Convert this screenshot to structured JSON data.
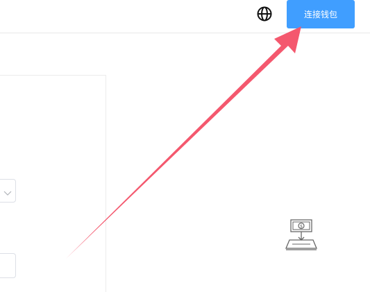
{
  "header": {
    "language_icon": "globe-icon",
    "connect_wallet_label": "连接钱包"
  },
  "colors": {
    "primary": "#409eff",
    "annotation_arrow": "#f4586e"
  },
  "illustration": {
    "icon": "withdraw-money-icon"
  }
}
